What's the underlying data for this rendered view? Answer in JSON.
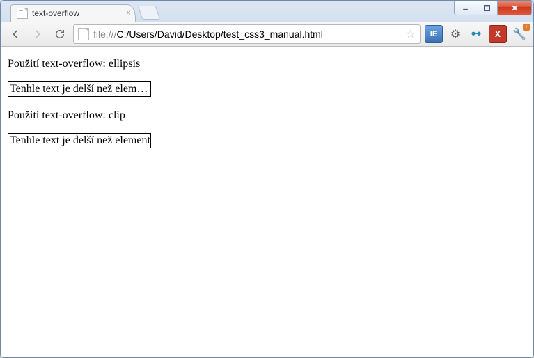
{
  "window": {
    "caption_buttons": {
      "minimize": "minimize",
      "maximize": "maximize",
      "close": "close"
    }
  },
  "tab": {
    "title": "text-overflow",
    "close_label": "×"
  },
  "toolbar": {
    "back": "Back",
    "forward": "Forward",
    "reload": "Reload",
    "url_scheme": "file:///",
    "url_path": "C:/Users/David/Desktop/test_css3_manual.html",
    "star": "☆",
    "ext_ie": "IE",
    "ext_gear": "⚙",
    "ext_snail": "ꕹ",
    "ext_x": "X",
    "ext_wrench": "🔧",
    "ext_wrench_badge": "!"
  },
  "page": {
    "heading_ellipsis": "Použití text-overflow: ellipsis",
    "sample_text_ellipsis": "Tenhle text je delší než element, ve kterém je umístěn",
    "heading_clip": "Použití text-overflow: clip",
    "sample_text_clip": "Tenhle text je delší než element, ve kterém je umístěn"
  }
}
